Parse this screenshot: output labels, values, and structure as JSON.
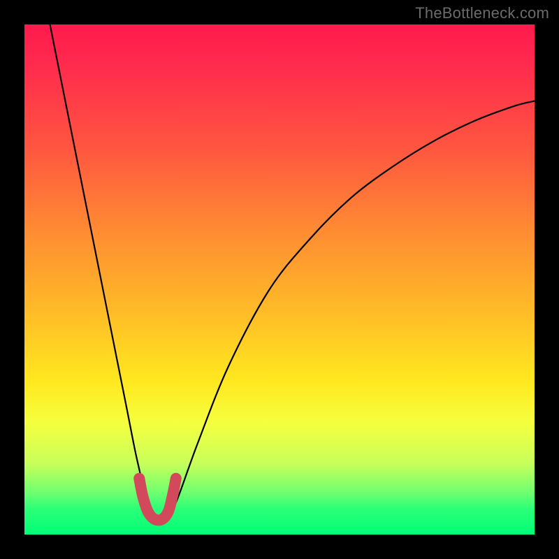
{
  "watermark": {
    "text": "TheBottleneck.com"
  },
  "chart_data": {
    "type": "line",
    "title": "",
    "xlabel": "",
    "ylabel": "",
    "xlim": [
      0,
      100
    ],
    "ylim": [
      0,
      100
    ],
    "grid": false,
    "series": [
      {
        "name": "bottleneck-curve",
        "x": [
          5,
          8,
          12,
          16,
          20,
          22,
          24,
          26,
          28,
          30,
          34,
          40,
          48,
          56,
          64,
          72,
          80,
          88,
          96,
          100
        ],
        "y": [
          100,
          85,
          65,
          45,
          25,
          15,
          7,
          3,
          3,
          7,
          18,
          33,
          48,
          58,
          66,
          72,
          77,
          81,
          84,
          85
        ]
      }
    ],
    "highlight": {
      "name": "trough-marker",
      "x": [
        22.5,
        23.2,
        24.2,
        25.5,
        27.0,
        28.2,
        29.0,
        29.7
      ],
      "y": [
        11.0,
        7.5,
        4.5,
        3.0,
        3.0,
        4.5,
        7.5,
        11.0
      ],
      "color": "#d1495b",
      "width": 16
    },
    "background_gradient": {
      "top": "#ff1a4d",
      "bottom": "#00ff77"
    }
  }
}
